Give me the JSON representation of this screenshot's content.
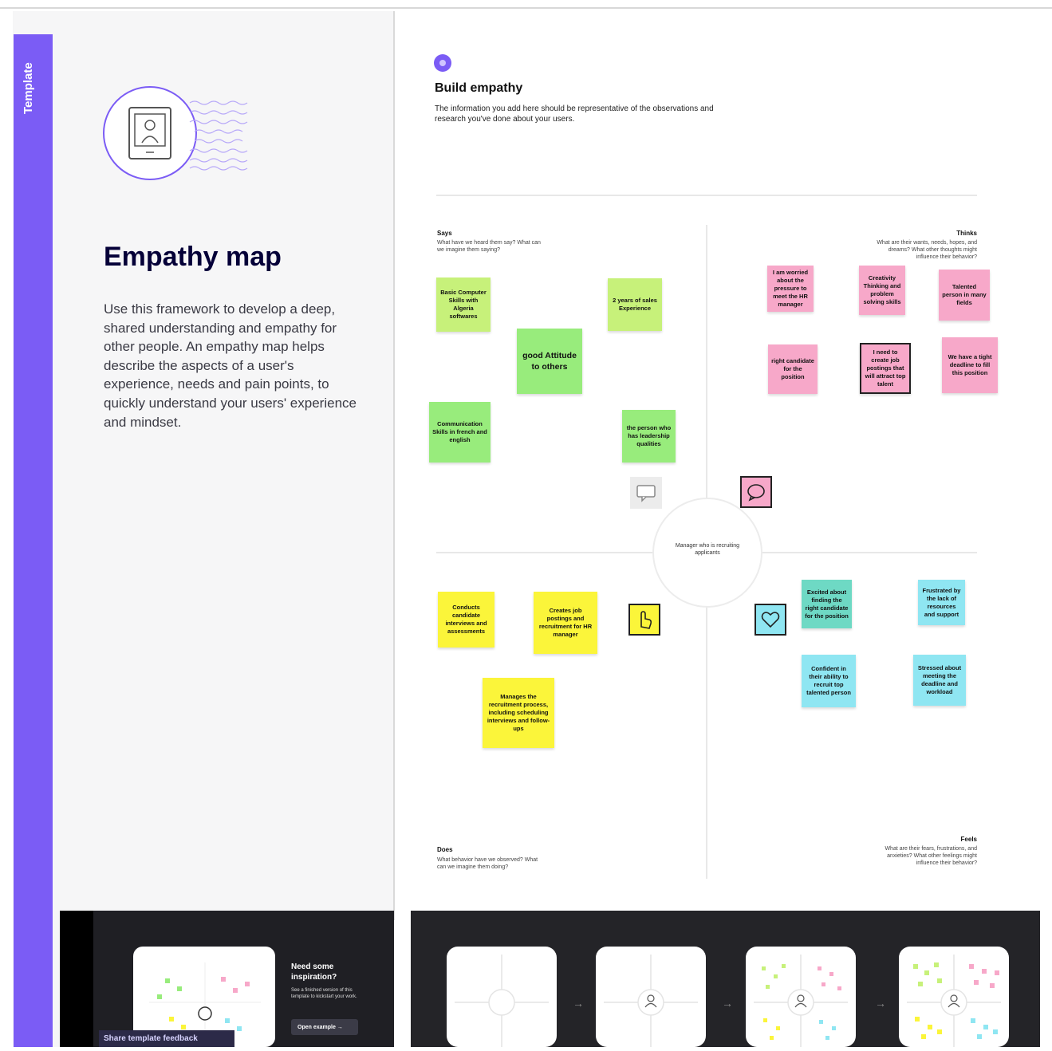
{
  "sidebar": {
    "tab_label": "Template",
    "title": "Empathy map",
    "description": "Use this framework to develop a deep, shared understanding and empathy for other people. An empathy map helps describe the aspects of a user's experience, needs and pain points, to quickly understand your users' experience and mindset."
  },
  "canvas": {
    "build_title": "Build empathy",
    "build_desc": "The information you add here should be representative of the observations and research you've done about your users.",
    "center_label": "Manager who is recruiting applicants",
    "quadrants": {
      "says": {
        "title": "Says",
        "question": "What have we heard them say? What can we imagine them saying?"
      },
      "thinks": {
        "title": "Thinks",
        "question": "What are their wants, needs, hopes, and dreams? What other thoughts might influence their behavior?"
      },
      "does": {
        "title": "Does",
        "question": "What behavior have we observed? What can we imagine them doing?"
      },
      "feels": {
        "title": "Feels",
        "question": "What are their fears, frustrations, and anxieties? What other feelings might influence their behavior?"
      }
    },
    "stickies": [
      {
        "text": "Basic Computer Skills with Algeria softwares",
        "color": "lime"
      },
      {
        "text": "2 years of sales Experience",
        "color": "lime"
      },
      {
        "text": "good Attitude to others",
        "color": "green"
      },
      {
        "text": "Communication Skills in french and english",
        "color": "green"
      },
      {
        "text": "the person who has leadership qualities",
        "color": "green"
      },
      {
        "text": "I am worried about the pressure to meet the HR manager",
        "color": "pink"
      },
      {
        "text": "Creativity Thinking and problem solving skills",
        "color": "pink"
      },
      {
        "text": "Talented person in many fields",
        "color": "pink"
      },
      {
        "text": "right candidate for the position",
        "color": "pink"
      },
      {
        "text": "I need to create job postings that will attract top talent",
        "color": "pink"
      },
      {
        "text": "We have a tight deadline to fill this position",
        "color": "pink"
      },
      {
        "text": "Conducts candidate interviews and assessments",
        "color": "yellow"
      },
      {
        "text": "Creates job postings and recruitment for HR manager",
        "color": "yellow"
      },
      {
        "text": "Manages the recruitment process, including scheduling interviews and follow-ups",
        "color": "yellow"
      },
      {
        "text": "Excited about finding the right candidate for the position",
        "color": "teal"
      },
      {
        "text": "Frustrated by the lack of resources and support",
        "color": "cyan"
      },
      {
        "text": "Confident in their ability to recruit top talented person",
        "color": "cyan"
      },
      {
        "text": "Stressed about meeting the deadline and workload",
        "color": "cyan"
      }
    ]
  },
  "bottom": {
    "need_title": "Need some inspiration?",
    "need_sub": "See a finished version of this template to kickstart your work.",
    "open_example": "Open example →",
    "feedback": "Share template feedback",
    "arrow": "→"
  },
  "colors": {
    "accent": "#7b5cf5",
    "green": "#98ec7c",
    "lime": "#c7f17a",
    "pink": "#f7a8c9",
    "yellow": "#fbf53a",
    "cyan": "#8fe6f2",
    "teal": "#6ed9c4"
  },
  "icons": [
    "portrait-icon",
    "speech-bubble-icon",
    "chat-icon",
    "hand-pointer-icon",
    "heart-icon",
    "user-icon"
  ]
}
